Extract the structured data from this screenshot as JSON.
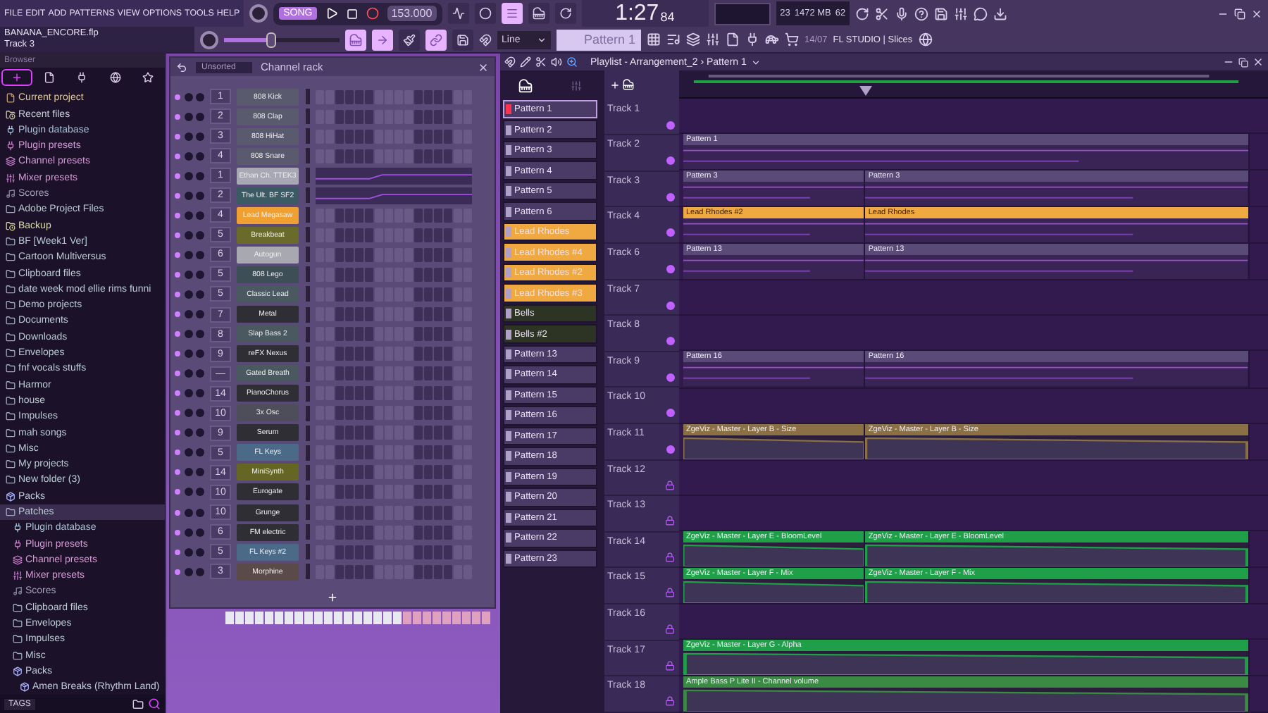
{
  "menu": [
    "FILE",
    "EDIT",
    "ADD",
    "PATTERNS",
    "VIEW",
    "OPTIONS",
    "TOOLS",
    "HELP"
  ],
  "transport": {
    "mode": "SONG",
    "tempo": "153.000"
  },
  "time": {
    "main": "1:27",
    "sub": "84"
  },
  "monitor": {
    "voices": "23",
    "memory": "1472 MB",
    "cpu": "62"
  },
  "hint": {
    "file": "BANANA_ENCORE.flp",
    "detail": "Track 3"
  },
  "pitch": {
    "level": 0.4
  },
  "snap": "Line",
  "pattern_select": "Pattern 1",
  "news": {
    "date": "14/07",
    "text": "FL STUDIO | Slices"
  },
  "browser": {
    "title": "Browser",
    "footer": "TAGS",
    "tabs": [
      {
        "selected": true
      },
      {
        "selected": false
      },
      {
        "selected": false
      },
      {
        "selected": false
      },
      {
        "selected": false
      }
    ],
    "items": [
      {
        "label": "Current project",
        "kind": "project",
        "selected": false
      },
      {
        "label": "Recent files",
        "kind": "recent",
        "selected": false
      },
      {
        "label": "Plugin database",
        "kind": "plugindb",
        "selected": false
      },
      {
        "label": "Plugin presets",
        "kind": "preset",
        "selected": false
      },
      {
        "label": "Channel presets",
        "kind": "channel",
        "selected": false
      },
      {
        "label": "Mixer presets",
        "kind": "mixer",
        "selected": false
      },
      {
        "label": "Scores",
        "kind": "scores",
        "selected": false
      },
      {
        "label": "Adobe Project Files",
        "kind": "folder",
        "selected": false
      },
      {
        "label": "Backup",
        "kind": "backup",
        "selected": false
      },
      {
        "label": "BF [Week1 Ver]",
        "kind": "folder",
        "selected": false
      },
      {
        "label": "Cartoon Multiversus",
        "kind": "folder",
        "selected": false
      },
      {
        "label": "Clipboard files",
        "kind": "folder",
        "selected": false
      },
      {
        "label": "date week mod ellie rims funni",
        "kind": "folder",
        "selected": false
      },
      {
        "label": "Demo projects",
        "kind": "folder",
        "selected": false
      },
      {
        "label": "Documents",
        "kind": "folder",
        "selected": false
      },
      {
        "label": "Downloads",
        "kind": "folder",
        "selected": false
      },
      {
        "label": "Envelopes",
        "kind": "folder",
        "selected": false
      },
      {
        "label": "fnf vocals stuffs",
        "kind": "folder",
        "selected": false
      },
      {
        "label": "Harmor",
        "kind": "folder",
        "selected": false
      },
      {
        "label": "house",
        "kind": "folder",
        "selected": false
      },
      {
        "label": "Impulses",
        "kind": "folder",
        "selected": false
      },
      {
        "label": "mah songs",
        "kind": "folder",
        "selected": false
      },
      {
        "label": "Misc",
        "kind": "folder",
        "selected": false
      },
      {
        "label": "My projects",
        "kind": "folder",
        "selected": false
      },
      {
        "label": "New folder (3)",
        "kind": "folder",
        "selected": false
      },
      {
        "label": "Packs",
        "kind": "packs",
        "selected": false
      },
      {
        "label": "Patches",
        "kind": "folder",
        "selected": true,
        "children": [
          {
            "label": "Plugin database",
            "kind": "plugindb",
            "selected": false
          },
          {
            "label": "Plugin presets",
            "kind": "preset",
            "selected": false
          },
          {
            "label": "Channel presets",
            "kind": "channel",
            "selected": false
          },
          {
            "label": "Mixer presets",
            "kind": "mixer",
            "selected": false
          },
          {
            "label": "Scores",
            "kind": "scores",
            "selected": false
          },
          {
            "label": "Clipboard files",
            "kind": "folder",
            "selected": false
          },
          {
            "label": "Envelopes",
            "kind": "folder",
            "selected": false
          },
          {
            "label": "Impulses",
            "kind": "folder",
            "selected": false
          },
          {
            "label": "Misc",
            "kind": "folder",
            "selected": false
          },
          {
            "label": "Packs",
            "kind": "packs",
            "selected": false,
            "children": [
              {
                "label": "Amen Breaks (Rhythm Land)",
                "kind": "packs",
                "selected": false
              }
            ]
          }
        ]
      }
    ]
  },
  "channel_rack": {
    "title": "Channel rack",
    "filter": "Unsorted",
    "channels": [
      {
        "number": "1",
        "name": "808 Kick",
        "color": "#5a5a6e",
        "kind": "steps"
      },
      {
        "number": "2",
        "name": "808 Clap",
        "color": "#5a5a6e",
        "kind": "steps"
      },
      {
        "number": "3",
        "name": "808 HiHat",
        "color": "#5a5a6e",
        "kind": "steps"
      },
      {
        "number": "4",
        "name": "808 Snare",
        "color": "#5a5a6e",
        "kind": "steps"
      },
      {
        "number": "1",
        "name": "Ethan Ch. TTEK3",
        "color": "#a8a8b4",
        "kind": "graph"
      },
      {
        "number": "2",
        "name": "The Ult. BF SF2",
        "color": "#3c5a64",
        "kind": "graph"
      },
      {
        "number": "4",
        "name": "Lead Megasaw",
        "color": "#f0a030",
        "kind": "steps"
      },
      {
        "number": "5",
        "name": "Breakbeat",
        "color": "#6a6a2a",
        "kind": "steps"
      },
      {
        "number": "6",
        "name": "Autogun",
        "color": "#a8a8b0",
        "kind": "steps"
      },
      {
        "number": "5",
        "name": "808 Lego",
        "color": "#3e4e56",
        "kind": "steps"
      },
      {
        "number": "5",
        "name": "Classic Lead",
        "color": "#4a5860",
        "kind": "steps"
      },
      {
        "number": "7",
        "name": "Metal",
        "color": "#2e2e34",
        "kind": "steps"
      },
      {
        "number": "8",
        "name": "Slap Bass 2",
        "color": "#4a5860",
        "kind": "steps"
      },
      {
        "number": "9",
        "name": "reFX Nexus",
        "color": "#2e2e34",
        "kind": "steps"
      },
      {
        "number": "—",
        "name": "Gated Breath",
        "color": "#4a5860",
        "kind": "steps"
      },
      {
        "number": "14",
        "name": "PianoChorus",
        "color": "#2e2e34",
        "kind": "steps"
      },
      {
        "number": "10",
        "name": "3x Osc",
        "color": "#4e4e5a",
        "kind": "steps"
      },
      {
        "number": "9",
        "name": "Serum",
        "color": "#2e2e34",
        "kind": "steps"
      },
      {
        "number": "5",
        "name": "FL Keys",
        "color": "#4a6a88",
        "kind": "steps"
      },
      {
        "number": "14",
        "name": "MiniSynth",
        "color": "#666624",
        "kind": "steps"
      },
      {
        "number": "10",
        "name": "Eurogate",
        "color": "#2e2e34",
        "kind": "steps"
      },
      {
        "number": "10",
        "name": "Grunge",
        "color": "#2e2e34",
        "kind": "steps"
      },
      {
        "number": "6",
        "name": "FM electric",
        "color": "#2e2e34",
        "kind": "steps"
      },
      {
        "number": "5",
        "name": "FL Keys #2",
        "color": "#4a6a88",
        "kind": "steps"
      },
      {
        "number": "3",
        "name": "Morphine",
        "color": "#5a4a48",
        "kind": "steps"
      }
    ]
  },
  "playlist": {
    "title": "Playlist - Arrangement_2 › Pattern 1",
    "patterns": [
      {
        "label": "Pattern 1",
        "color": "#4a3a66",
        "selected": true
      },
      {
        "label": "Pattern 2",
        "color": "#4a3a66",
        "selected": false
      },
      {
        "label": "Pattern 3",
        "color": "#4a3a66",
        "selected": false
      },
      {
        "label": "Pattern 4",
        "color": "#4a3a66",
        "selected": false
      },
      {
        "label": "Pattern 5",
        "color": "#4a3a66",
        "selected": false
      },
      {
        "label": "Pattern 6",
        "color": "#4a3a66",
        "selected": false
      },
      {
        "label": "Lead Rhodes",
        "color": "#f0a840",
        "selected": false
      },
      {
        "label": "Lead Rhodes #4",
        "color": "#f0a840",
        "selected": false
      },
      {
        "label": "Lead Rhodes #2",
        "color": "#f0a840",
        "selected": false
      },
      {
        "label": "Lead Rhodes #3",
        "color": "#f0a840",
        "selected": false
      },
      {
        "label": "Bells",
        "color": "#2e3424",
        "selected": false
      },
      {
        "label": "Bells #2",
        "color": "#2e3424",
        "selected": false
      },
      {
        "label": "Pattern 13",
        "color": "#4a3a66",
        "selected": false
      },
      {
        "label": "Pattern 14",
        "color": "#4a3a66",
        "selected": false
      },
      {
        "label": "Pattern 15",
        "color": "#4a3a66",
        "selected": false
      },
      {
        "label": "Pattern 16",
        "color": "#4a3a66",
        "selected": false
      },
      {
        "label": "Pattern 17",
        "color": "#4a3a66",
        "selected": false
      },
      {
        "label": "Pattern 18",
        "color": "#4a3a66",
        "selected": false
      },
      {
        "label": "Pattern 19",
        "color": "#4a3a66",
        "selected": false
      },
      {
        "label": "Pattern 20",
        "color": "#4a3a66",
        "selected": false
      },
      {
        "label": "Pattern 21",
        "color": "#4a3a66",
        "selected": false
      },
      {
        "label": "Pattern 22",
        "color": "#4a3a66",
        "selected": false
      },
      {
        "label": "Pattern 23",
        "color": "#4a3a66",
        "selected": false
      }
    ],
    "tracks": [
      {
        "label": "Track 1",
        "locked": false
      },
      {
        "label": "Track 2",
        "locked": false,
        "clips": [
          {
            "label": "Pattern 1",
            "kind": "pattern",
            "full": true,
            "color": "#5a4a78"
          }
        ]
      },
      {
        "label": "Track 3",
        "locked": false,
        "clips": [
          {
            "label": "Pattern 3",
            "kind": "pattern",
            "full": false,
            "color": "#5a4a78"
          },
          {
            "label": "Pattern 3",
            "kind": "pattern",
            "full": false,
            "color": "#5a4a78"
          }
        ]
      },
      {
        "label": "Track 4",
        "locked": false,
        "clips": [
          {
            "label": "Lead Rhodes #2",
            "kind": "pattern",
            "full": false,
            "color": "#f0a840"
          },
          {
            "label": "Lead Rhodes",
            "kind": "pattern",
            "full": false,
            "color": "#f0a840"
          }
        ]
      },
      {
        "label": "Track 6",
        "locked": false,
        "clips": [
          {
            "label": "Pattern 13",
            "kind": "pattern",
            "full": false,
            "color": "#5a4a78"
          },
          {
            "label": "Pattern 13",
            "kind": "pattern",
            "full": false,
            "color": "#5a4a78"
          }
        ]
      },
      {
        "label": "Track 7",
        "locked": false
      },
      {
        "label": "Track 8",
        "locked": false
      },
      {
        "label": "Track 9",
        "locked": false,
        "clips": [
          {
            "label": "Pattern 16",
            "kind": "pattern",
            "full": false,
            "color": "#5a4a78"
          },
          {
            "label": "Pattern 16",
            "kind": "pattern",
            "full": false,
            "color": "#5a4a78"
          }
        ]
      },
      {
        "label": "Track 10",
        "locked": false
      },
      {
        "label": "Track 11",
        "locked": false,
        "clips": [
          {
            "label": "ZgeViz - Master - Layer B - Size",
            "kind": "automation",
            "full": false,
            "color": "#8a7044"
          },
          {
            "label": "ZgeViz - Master - Layer B - Size",
            "kind": "automation",
            "full": false,
            "color": "#8a7044"
          }
        ]
      },
      {
        "label": "Track 12",
        "locked": true
      },
      {
        "label": "Track 13",
        "locked": true
      },
      {
        "label": "Track 14",
        "locked": true,
        "clips": [
          {
            "label": "ZgeViz - Master - Layer E - BloomLevel",
            "kind": "automation",
            "full": false,
            "color": "#1fa048"
          },
          {
            "label": "ZgeViz - Master - Layer E - BloomLevel",
            "kind": "automation",
            "full": false,
            "color": "#1fa048"
          }
        ]
      },
      {
        "label": "Track 15",
        "locked": true,
        "clips": [
          {
            "label": "ZgeViz - Master - Layer F - Mix",
            "kind": "automation",
            "full": false,
            "color": "#1fa048"
          },
          {
            "label": "ZgeViz - Master - Layer F - Mix",
            "kind": "automation",
            "full": false,
            "color": "#1fa048"
          }
        ]
      },
      {
        "label": "Track 16",
        "locked": true
      },
      {
        "label": "Track 17",
        "locked": true,
        "clips": [
          {
            "label": "ZgeViz - Master - Layer G - Alpha",
            "kind": "automation",
            "full": true,
            "color": "#1fa048"
          }
        ]
      },
      {
        "label": "Track 18",
        "locked": true,
        "clips": [
          {
            "label": "Ample Bass P Lite II - Channel volume",
            "kind": "automation",
            "full": true,
            "color": "#3a8a44"
          }
        ]
      }
    ]
  }
}
